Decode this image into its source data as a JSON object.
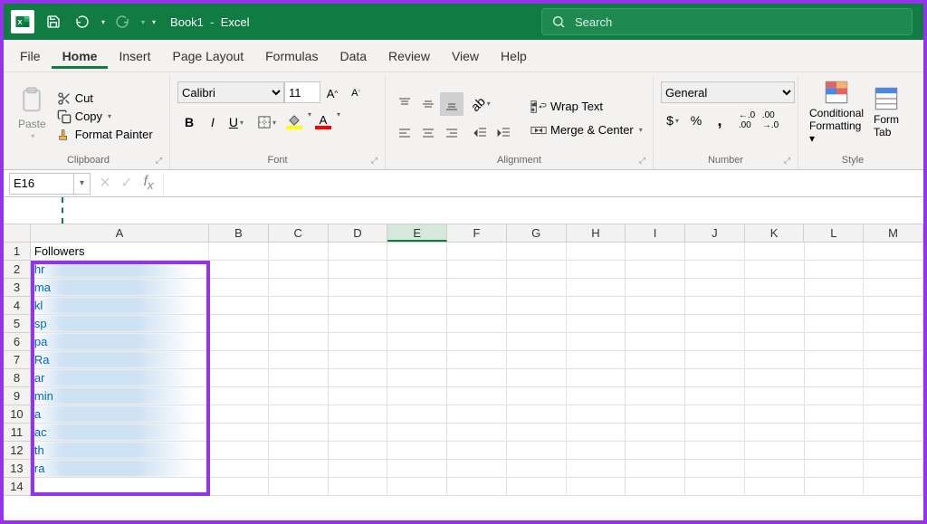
{
  "titlebar": {
    "doc_title": "Book1",
    "app_name": "Excel",
    "search_placeholder": "Search"
  },
  "tabs": [
    "File",
    "Home",
    "Insert",
    "Page Layout",
    "Formulas",
    "Data",
    "Review",
    "View",
    "Help"
  ],
  "active_tab": "Home",
  "ribbon": {
    "clipboard": {
      "paste": "Paste",
      "cut": "Cut",
      "copy": "Copy",
      "format_painter": "Format Painter",
      "label": "Clipboard"
    },
    "font": {
      "name": "Calibri",
      "size": "11",
      "label": "Font",
      "highlight_color": "#ffff00",
      "font_color": "#ff0000"
    },
    "alignment": {
      "wrap": "Wrap Text",
      "merge": "Merge & Center",
      "label": "Alignment"
    },
    "number": {
      "format": "General",
      "label": "Number"
    },
    "styles": {
      "cond": "Conditional",
      "cond2": "Formatting",
      "table": "Form",
      "table2": "Tab",
      "label": "Style"
    }
  },
  "fxbar": {
    "namebox": "E16",
    "formula": ""
  },
  "grid": {
    "columns": [
      "A",
      "B",
      "C",
      "D",
      "E",
      "F",
      "G",
      "H",
      "I",
      "J",
      "K",
      "L",
      "M"
    ],
    "selected_col": "E",
    "header_row": {
      "A": "Followers"
    },
    "rows": [
      {
        "prefix": "hr"
      },
      {
        "prefix": "ma"
      },
      {
        "prefix": "kl"
      },
      {
        "prefix": "sp"
      },
      {
        "prefix": "pa"
      },
      {
        "prefix": "Ra"
      },
      {
        "prefix": "ar"
      },
      {
        "prefix": "min"
      },
      {
        "prefix": "a"
      },
      {
        "prefix": "ac"
      },
      {
        "prefix": "th"
      },
      {
        "prefix": "ra"
      }
    ],
    "total_rows": 14
  }
}
